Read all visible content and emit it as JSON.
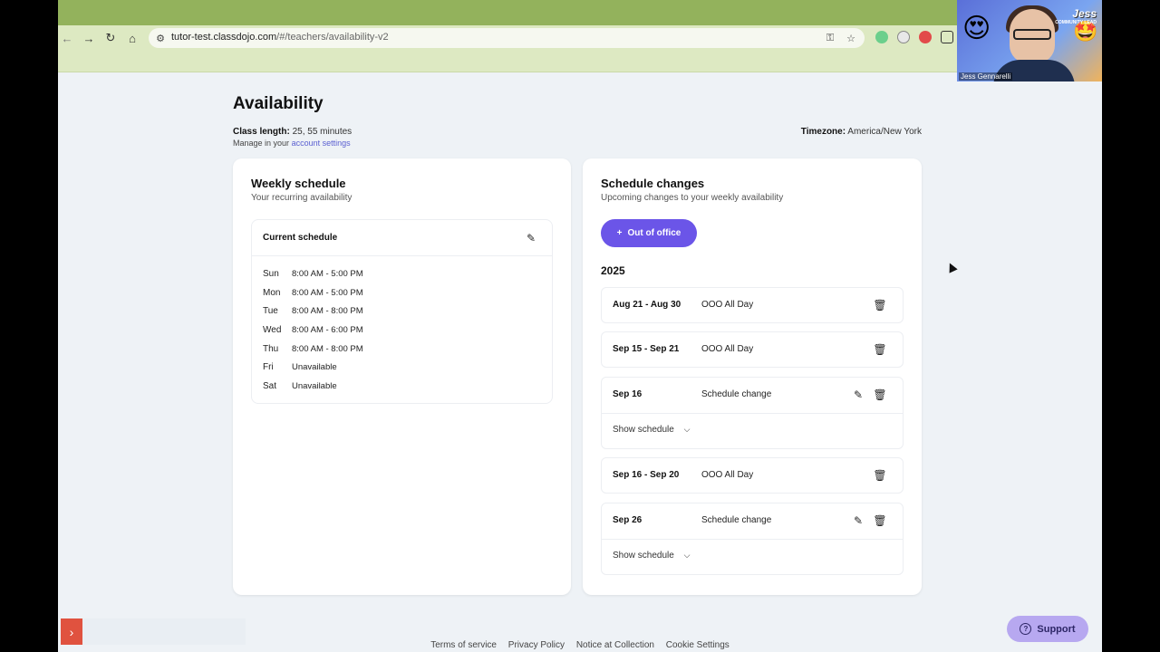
{
  "browser": {
    "url_host": "tutor-test.classdojo.com",
    "url_path": "/#/teachers/availability-v2",
    "back_icon": "arrow-left-icon",
    "forward_icon": "arrow-right-icon",
    "reload_icon": "reload-icon",
    "home_icon": "home-icon"
  },
  "video": {
    "brand": "Jess",
    "brand_sub": "COMMUNITY LEAD",
    "name": "Jess Gennarelli"
  },
  "page": {
    "title": "Availability",
    "class_length_label": "Class length:",
    "class_length_value": "25, 55 minutes",
    "manage_prefix": "Manage in your",
    "manage_link": "account settings",
    "timezone_label": "Timezone:",
    "timezone_value": "America/New York"
  },
  "weekly": {
    "title": "Weekly schedule",
    "subtitle": "Your recurring availability",
    "current_label": "Current schedule",
    "days": [
      {
        "day": "Sun",
        "hours": "8:00 AM - 5:00 PM"
      },
      {
        "day": "Mon",
        "hours": "8:00 AM - 5:00 PM"
      },
      {
        "day": "Tue",
        "hours": "8:00 AM - 8:00 PM"
      },
      {
        "day": "Wed",
        "hours": "8:00 AM - 6:00 PM"
      },
      {
        "day": "Thu",
        "hours": "8:00 AM - 8:00 PM"
      },
      {
        "day": "Fri",
        "hours": "Unavailable"
      },
      {
        "day": "Sat",
        "hours": "Unavailable"
      }
    ]
  },
  "changes": {
    "title": "Schedule changes",
    "subtitle": "Upcoming changes to your weekly availability",
    "ooo_button": "Out of office",
    "year": "2025",
    "items": [
      {
        "dates": "Aug 21 - Aug 30",
        "kind": "OOO All Day"
      },
      {
        "dates": "Sep 15 - Sep 21",
        "kind": "OOO All Day"
      },
      {
        "dates": "Sep 16",
        "kind": "Schedule change",
        "show": "Show schedule"
      },
      {
        "dates": "Sep 16 - Sep 20",
        "kind": "OOO All Day"
      },
      {
        "dates": "Sep 26",
        "kind": "Schedule change",
        "show": "Show schedule"
      }
    ]
  },
  "support": {
    "label": "Support"
  },
  "footer": {
    "links": [
      "Terms of service",
      "Privacy Policy",
      "Notice at Collection",
      "Cookie Settings"
    ]
  },
  "colors": {
    "accent": "#6b55e8",
    "support_bg": "#b7a8f0",
    "chrome": "#93b25c"
  }
}
